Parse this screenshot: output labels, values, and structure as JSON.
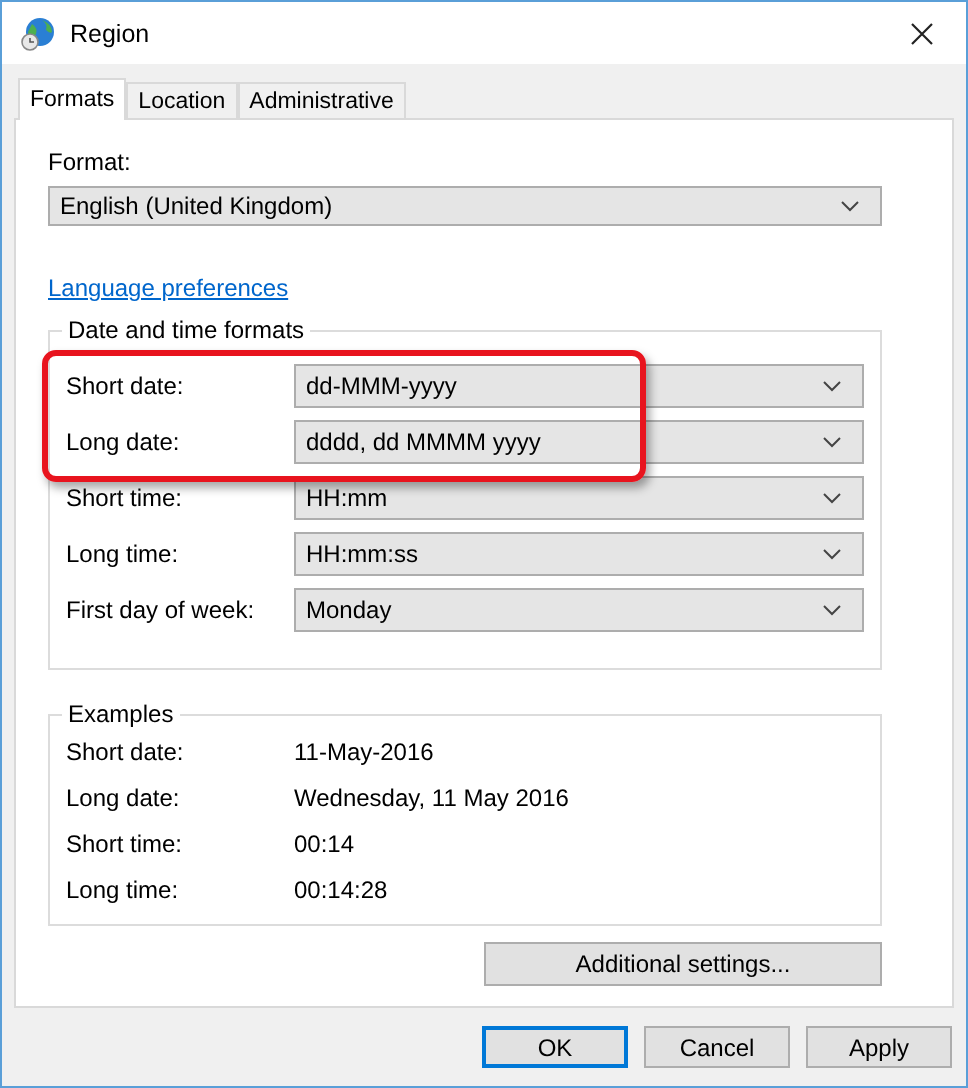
{
  "window": {
    "title": "Region"
  },
  "tabs": [
    {
      "label": "Formats",
      "selected": true
    },
    {
      "label": "Location",
      "selected": false
    },
    {
      "label": "Administrative",
      "selected": false
    }
  ],
  "format": {
    "label": "Format:",
    "value": "English (United Kingdom)"
  },
  "language_link": "Language preferences",
  "date_time_formats": {
    "title": "Date and time formats",
    "rows": [
      {
        "label": "Short date:",
        "value": "dd-MMM-yyyy",
        "highlighted": true
      },
      {
        "label": "Long date:",
        "value": "dddd, dd MMMM yyyy",
        "highlighted": true
      },
      {
        "label": "Short time:",
        "value": "HH:mm",
        "highlighted": false
      },
      {
        "label": "Long time:",
        "value": "HH:mm:ss",
        "highlighted": false
      },
      {
        "label": "First day of week:",
        "value": "Monday",
        "highlighted": false
      }
    ]
  },
  "examples": {
    "title": "Examples",
    "rows": [
      {
        "label": "Short date:",
        "value": "11-May-2016"
      },
      {
        "label": "Long date:",
        "value": "Wednesday, 11 May 2016"
      },
      {
        "label": "Short time:",
        "value": "00:14"
      },
      {
        "label": "Long time:",
        "value": "00:14:28"
      }
    ]
  },
  "additional_button": "Additional settings...",
  "buttons": [
    {
      "label": "OK",
      "default": true
    },
    {
      "label": "Cancel",
      "default": false
    },
    {
      "label": "Apply",
      "default": false
    }
  ]
}
